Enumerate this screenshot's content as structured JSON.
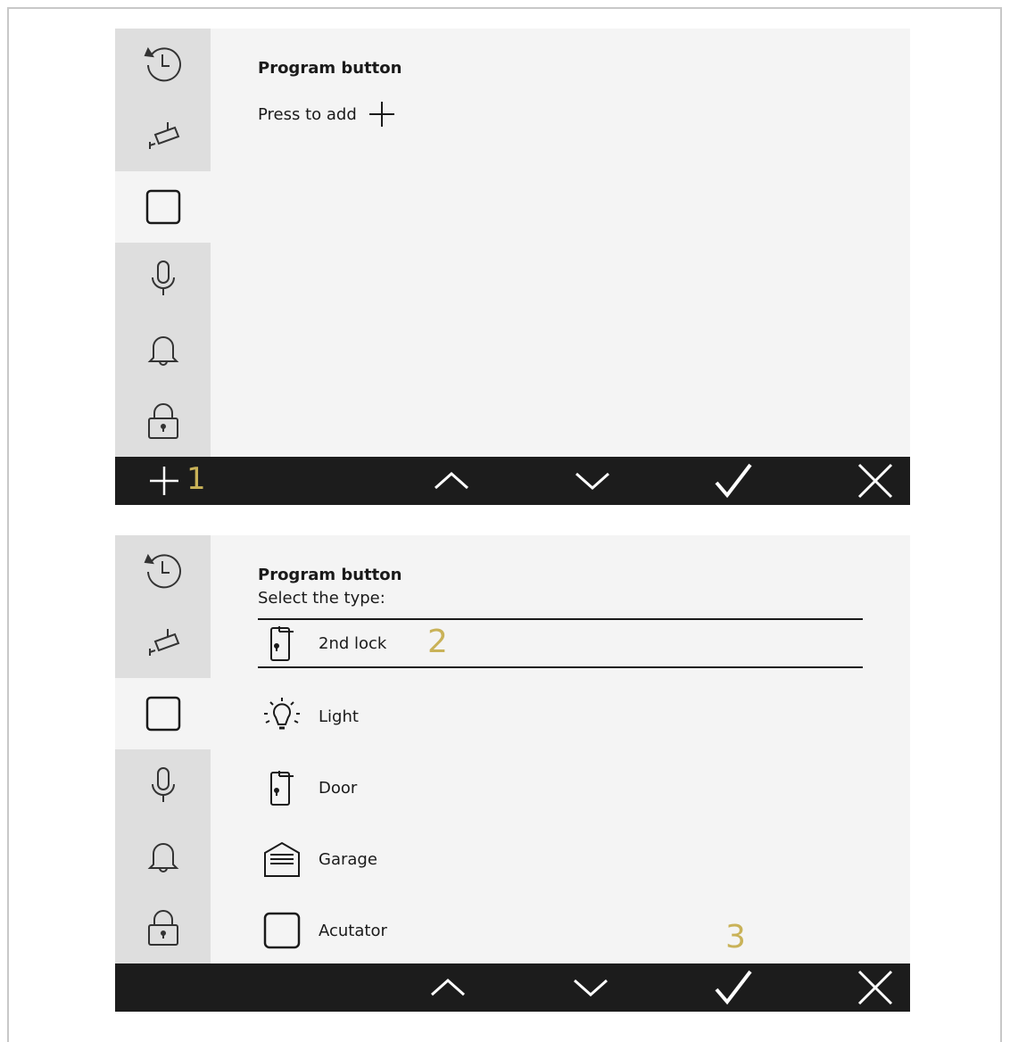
{
  "screens": [
    {
      "title": "Program button",
      "press_to_add": "Press to add",
      "callout_add": "1"
    },
    {
      "title": "Program button",
      "subtitle": "Select the type:",
      "items": [
        {
          "label": "2nd lock",
          "icon": "lock-door-icon"
        },
        {
          "label": "Light",
          "icon": "light-bulb-icon"
        },
        {
          "label": "Door",
          "icon": "door-icon"
        },
        {
          "label": "Garage",
          "icon": "garage-icon"
        },
        {
          "label": "Acutator",
          "icon": "actuator-icon"
        }
      ],
      "callout_item": "2",
      "callout_confirm": "3"
    }
  ],
  "sidebar_icons": [
    "history-icon",
    "camera-icon",
    "button-square-icon",
    "microphone-icon",
    "bell-icon",
    "padlock-icon"
  ],
  "colors": {
    "callout": "#c9b258",
    "bar": "#1c1c1c",
    "sidebar": "#dedede",
    "background": "#f4f4f4"
  }
}
